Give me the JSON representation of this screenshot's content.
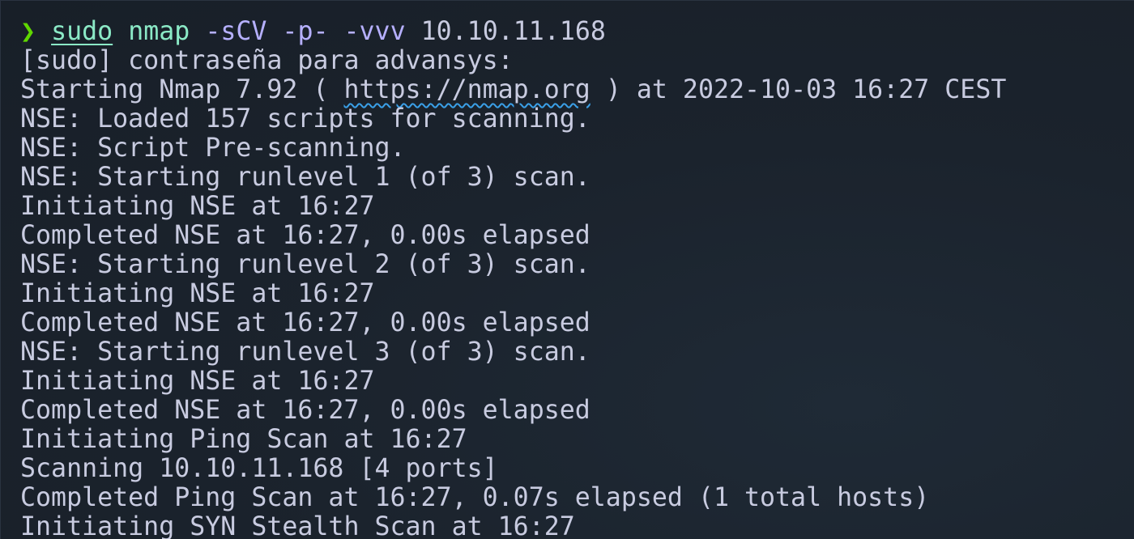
{
  "terminal": {
    "prompt": {
      "arrow": "❯",
      "sudo": "sudo",
      "command": "nmap",
      "args": "-sCV -p- -vvv",
      "target": "10.10.11.168"
    },
    "password_prompt": "[sudo] contraseña para advansys:",
    "start_line": {
      "before": "Starting Nmap 7.92 ( ",
      "url": "https://nmap.org",
      "after": " ) at 2022-10-03 16:27 CEST"
    },
    "output": [
      "NSE: Loaded 157 scripts for scanning.",
      "NSE: Script Pre-scanning.",
      "NSE: Starting runlevel 1 (of 3) scan.",
      "Initiating NSE at 16:27",
      "Completed NSE at 16:27, 0.00s elapsed",
      "NSE: Starting runlevel 2 (of 3) scan.",
      "Initiating NSE at 16:27",
      "Completed NSE at 16:27, 0.00s elapsed",
      "NSE: Starting runlevel 3 (of 3) scan.",
      "Initiating NSE at 16:27",
      "Completed NSE at 16:27, 0.00s elapsed",
      "Initiating Ping Scan at 16:27",
      "Scanning 10.10.11.168 [4 ports]",
      "Completed Ping Scan at 16:27, 0.07s elapsed (1 total hosts)",
      "Initiating SYN Stealth Scan at 16:27"
    ]
  }
}
